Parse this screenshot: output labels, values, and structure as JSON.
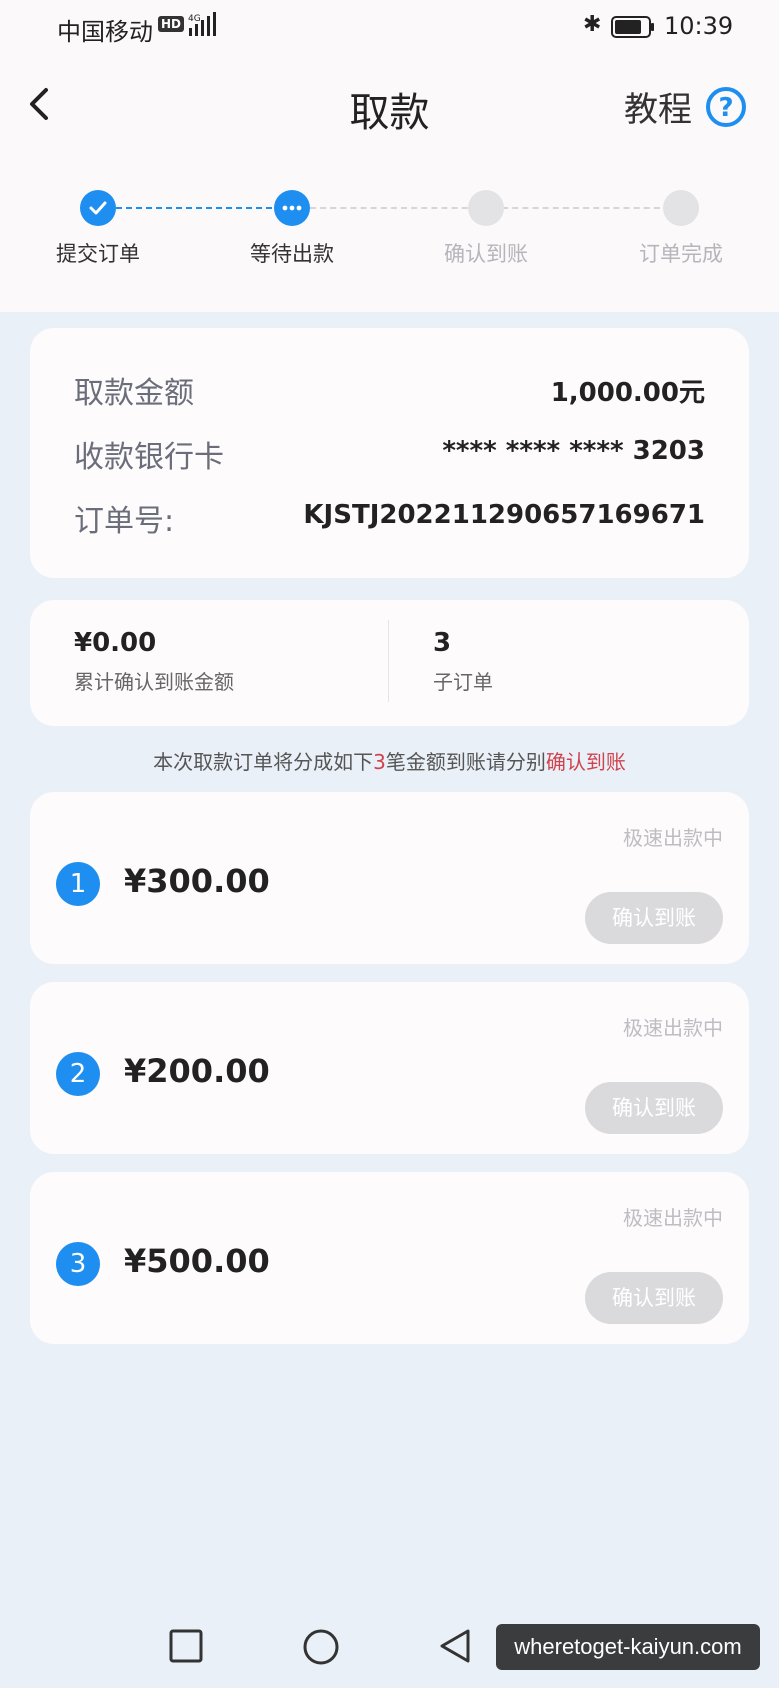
{
  "status_bar": {
    "carrier": "中国移动",
    "hd": "HD",
    "network": "4G",
    "time": "10:39"
  },
  "header": {
    "title": "取款",
    "tutorial_label": "教程",
    "help_symbol": "?"
  },
  "stepper": {
    "steps": [
      {
        "label": "提交订单",
        "state": "done"
      },
      {
        "label": "等待出款",
        "state": "current"
      },
      {
        "label": "确认到账",
        "state": "pending"
      },
      {
        "label": "订单完成",
        "state": "pending"
      }
    ]
  },
  "order": {
    "amount_label": "取款金额",
    "amount_value": "1,000.00元",
    "card_label": "收款银行卡",
    "card_value": "**** **** **** 3203",
    "order_no_label": "订单号:",
    "order_no_value": "KJSTJ202211290657169671"
  },
  "summary": {
    "confirmed_amount": "¥0.00",
    "confirmed_caption": "累计确认到账金额",
    "sub_order_count": "3",
    "sub_order_caption": "子订单"
  },
  "notice": {
    "prefix": "本次取款订单将分成如下",
    "count": "3",
    "middle": "笔金额到账请分别",
    "action": "确认到账"
  },
  "sub_orders": [
    {
      "index": "1",
      "amount": "¥300.00",
      "status": "极速出款中",
      "button": "确认到账"
    },
    {
      "index": "2",
      "amount": "¥200.00",
      "status": "极速出款中",
      "button": "确认到账"
    },
    {
      "index": "3",
      "amount": "¥500.00",
      "status": "极速出款中",
      "button": "确认到账"
    }
  ],
  "watermark": "wheretoget-kaiyun.com",
  "colors": {
    "accent": "#1e8ef0",
    "highlight_red": "#d0434e",
    "disabled_button": "#dadadc",
    "page_bg": "#eaf0f8"
  }
}
